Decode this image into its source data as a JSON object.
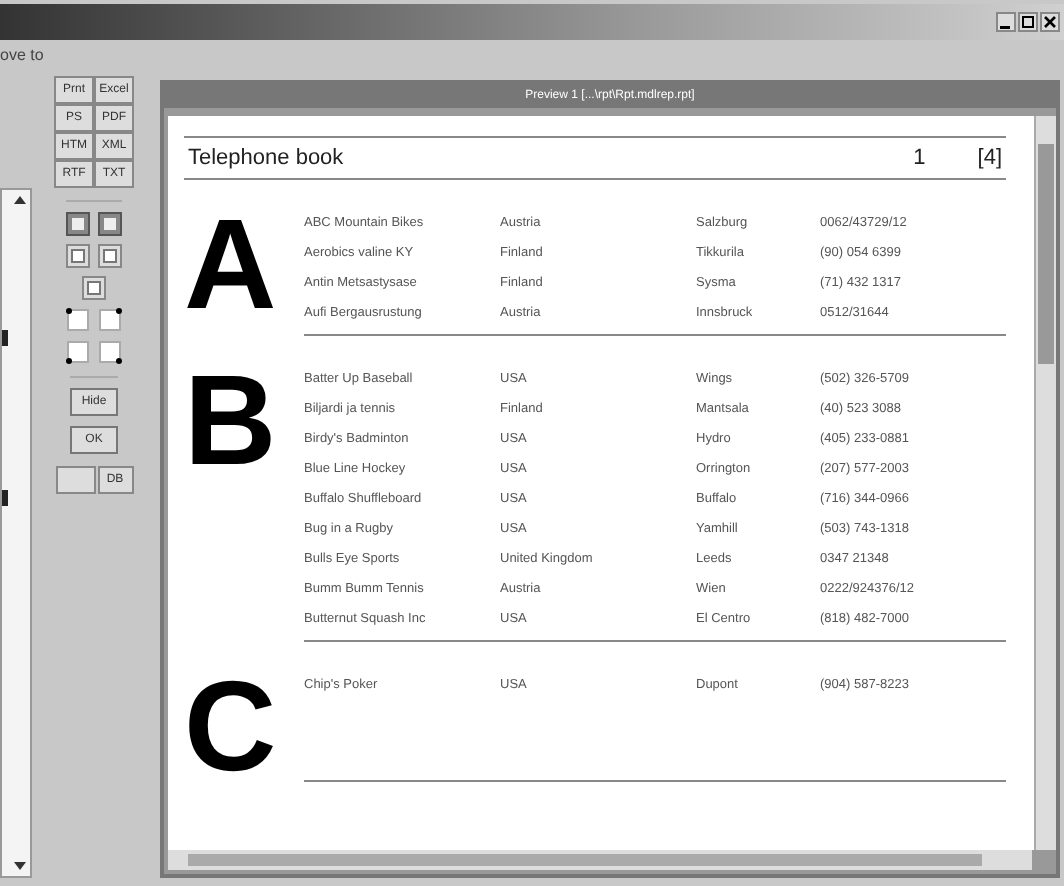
{
  "menu": [
    "ove to"
  ],
  "export_buttons": [
    "Prnt",
    "Excel",
    "PS",
    "PDF",
    "HTM",
    "XML",
    "RTF",
    "TXT"
  ],
  "action_buttons": [
    "Hide",
    "OK"
  ],
  "db_button": "DB",
  "preview": {
    "title": "Preview 1 [...\\rpt\\Rpt.mdlrep.rpt]",
    "report": {
      "title": "Telephone book",
      "page": "1",
      "pages": "[4]",
      "groups": [
        {
          "letter": "A",
          "rows": [
            {
              "name": "ABC Mountain Bikes",
              "country": "Austria",
              "city": "Salzburg",
              "phone": "0062/43729/12"
            },
            {
              "name": "Aerobics valine KY",
              "country": "Finland",
              "city": "Tikkurila",
              "phone": "(90) 054 6399"
            },
            {
              "name": "Antin Metsastysase",
              "country": "Finland",
              "city": "Sysma",
              "phone": "(71) 432 1317"
            },
            {
              "name": "Aufi Bergausrustung",
              "country": "Austria",
              "city": "Innsbruck",
              "phone": "0512/31644"
            }
          ]
        },
        {
          "letter": "B",
          "rows": [
            {
              "name": "Batter Up Baseball",
              "country": "USA",
              "city": "Wings",
              "phone": "(502) 326-5709"
            },
            {
              "name": "Biljardi ja tennis",
              "country": "Finland",
              "city": "Mantsala",
              "phone": "(40) 523 3088"
            },
            {
              "name": "Birdy's Badminton",
              "country": "USA",
              "city": "Hydro",
              "phone": "(405) 233-0881"
            },
            {
              "name": "Blue Line Hockey",
              "country": "USA",
              "city": "Orrington",
              "phone": "(207) 577-2003"
            },
            {
              "name": "Buffalo Shuffleboard",
              "country": "USA",
              "city": "Buffalo",
              "phone": "(716) 344-0966"
            },
            {
              "name": "Bug in a Rugby",
              "country": "USA",
              "city": "Yamhill",
              "phone": "(503) 743-1318"
            },
            {
              "name": "Bulls Eye Sports",
              "country": "United Kingdom",
              "city": "Leeds",
              "phone": "0347 21348"
            },
            {
              "name": "Bumm Bumm Tennis",
              "country": "Austria",
              "city": "Wien",
              "phone": "0222/924376/12"
            },
            {
              "name": "Butternut Squash Inc",
              "country": "USA",
              "city": "El Centro",
              "phone": "(818) 482-7000"
            }
          ]
        },
        {
          "letter": "C",
          "rows": [
            {
              "name": "Chip's Poker",
              "country": "USA",
              "city": "Dupont",
              "phone": "(904) 587-8223"
            }
          ]
        }
      ]
    }
  }
}
